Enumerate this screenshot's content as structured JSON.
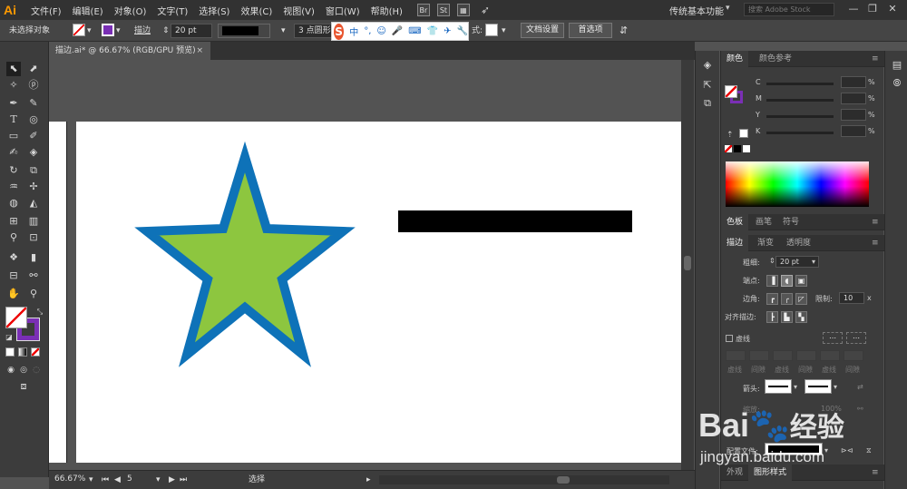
{
  "app": {
    "logo": "Ai"
  },
  "menus": [
    "文件(F)",
    "编辑(E)",
    "对象(O)",
    "文字(T)",
    "选择(S)",
    "效果(C)",
    "视图(V)",
    "窗口(W)",
    "帮助(H)"
  ],
  "menu_badges": [
    "Br",
    "St"
  ],
  "workspace": "传统基本功能",
  "stock_search": {
    "placeholder": "搜索 Adobe Stock"
  },
  "control_bar": {
    "selection": "未选择对象",
    "stroke_label": "描边",
    "stroke_weight": "20 pt",
    "brush_value": "3 点圆形",
    "style_label": "式:",
    "doc_setup": "文档设置",
    "preferences": "首选项"
  },
  "ime": {
    "logo": "S",
    "items": [
      "中",
      "°,",
      "☺",
      "🎤",
      "⌨",
      "👕",
      "✈",
      "🔧"
    ]
  },
  "document": {
    "tab_title": "描边.ai* @ 66.67% (RGB/GPU 预览)",
    "close": "×"
  },
  "status_bar": {
    "zoom": "66.67%",
    "page": "5",
    "tool": "选择"
  },
  "color_panel": {
    "tabs": [
      "颜色",
      "颜色参考"
    ],
    "channels": [
      "C",
      "M",
      "Y",
      "K"
    ],
    "percent": "%"
  },
  "swatches_panel": {
    "tabs": [
      "色板",
      "画笔",
      "符号"
    ]
  },
  "stroke_panel": {
    "tabs": [
      "描边",
      "渐变",
      "透明度"
    ],
    "weight_label": "粗细:",
    "weight": "20 pt",
    "cap_label": "端点:",
    "corner_label": "边角:",
    "limit_label": "限制:",
    "limit": "10",
    "limit_unit": "x",
    "align_label": "对齐描边:",
    "dashed_label": "虚线",
    "dash_cells": [
      "虚线",
      "间隙",
      "虚线",
      "间隙",
      "虚线",
      "间隙"
    ],
    "arrow_label": "箭头:",
    "scale_label": "缩放:",
    "scale_value": "100%",
    "profile_label": "配置文件:"
  },
  "bottom_tabs": [
    "外观",
    "图形样式"
  ],
  "watermark": {
    "brand": "Bai",
    "brand2": "经验",
    "url": "jingyan.baidu.com"
  },
  "colors": {
    "star_fill": "#8dc63f",
    "star_stroke": "#0e72b8",
    "line": "#000000",
    "fill_accent": "#7a2fb5"
  }
}
